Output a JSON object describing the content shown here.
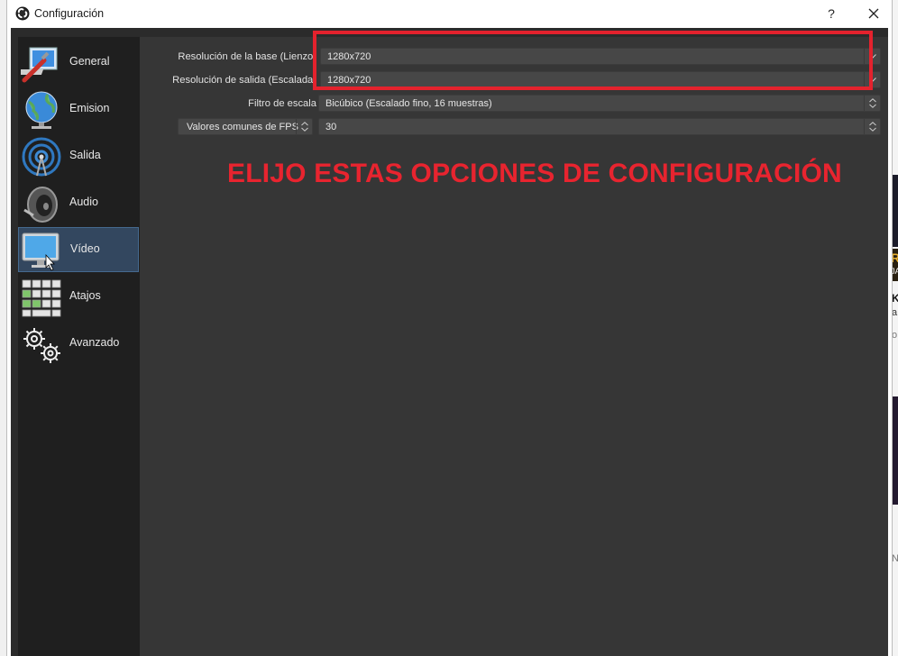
{
  "window": {
    "title": "Configuración",
    "help_label": "?"
  },
  "sidebar": {
    "items": [
      {
        "label": "General",
        "icon": "general-icon"
      },
      {
        "label": "Emision",
        "icon": "globe-icon"
      },
      {
        "label": "Salida",
        "icon": "broadcast-icon"
      },
      {
        "label": "Audio",
        "icon": "speaker-icon"
      },
      {
        "label": "Vídeo",
        "icon": "monitor-icon",
        "active": true
      },
      {
        "label": "Atajos",
        "icon": "keyboard-icon"
      },
      {
        "label": "Avanzado",
        "icon": "gears-icon"
      }
    ]
  },
  "video": {
    "base_resolution": {
      "label": "Resolución de la base (Lienzo)",
      "value": "1280x720"
    },
    "output_resolution": {
      "label": "Resolución de salida (Escalada)",
      "value": "1280x720"
    },
    "scale_filter": {
      "label": "Filtro de escala",
      "value": "Bicúbico (Escalado fino, 16 muestras)"
    },
    "fps": {
      "label": "Valores comunes de FPS",
      "value": "30"
    }
  },
  "annotation": {
    "text": "ELIJO ESTAS OPCIONES DE CONFIGURACIÓN",
    "color": "#e8242f"
  },
  "background_page": {
    "fragments": [
      "R",
      "JA",
      "K",
      "a",
      "o",
      "N"
    ]
  },
  "colors": {
    "client_bg": "#2b2b2b",
    "sidebar_bg": "#1f1f1f",
    "content_bg": "#363636",
    "active_item_bg": "#33475f",
    "highlight": "#e4222d"
  }
}
